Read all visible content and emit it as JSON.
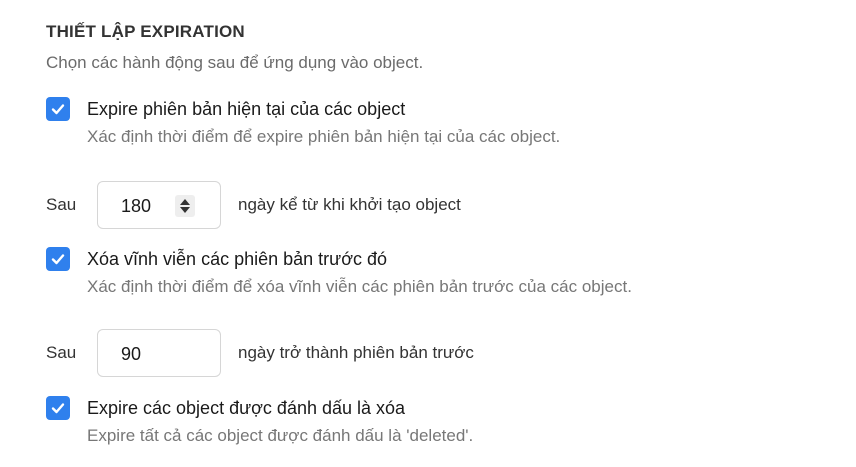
{
  "colors": {
    "accent": "#2f80ed"
  },
  "section": {
    "title": "THIẾT LẬP EXPIRATION",
    "subtitle": "Chọn các hành động sau để ứng dụng vào object."
  },
  "options": [
    {
      "checked": true,
      "label": "Expire phiên bản hiện tại của các object",
      "description": "Xác định thời điểm để expire phiên bản hiện tại của các object."
    },
    {
      "checked": true,
      "label": "Xóa vĩnh viễn các phiên bản trước đó",
      "description": "Xác định thời điểm để xóa vĩnh viễn các phiên bản trước của các object."
    },
    {
      "checked": true,
      "label": "Expire các object được đánh dấu là xóa",
      "description": "Expire tất cả các object được đánh dấu là 'deleted'."
    }
  ],
  "rows": [
    {
      "prefix": "Sau",
      "value": "180",
      "suffix": "ngày kể từ khi khởi tạo object",
      "stepper_icon": "updown-arrows-icon"
    },
    {
      "prefix": "Sau",
      "value": "90",
      "suffix": "ngày trở thành phiên bản trước"
    }
  ]
}
